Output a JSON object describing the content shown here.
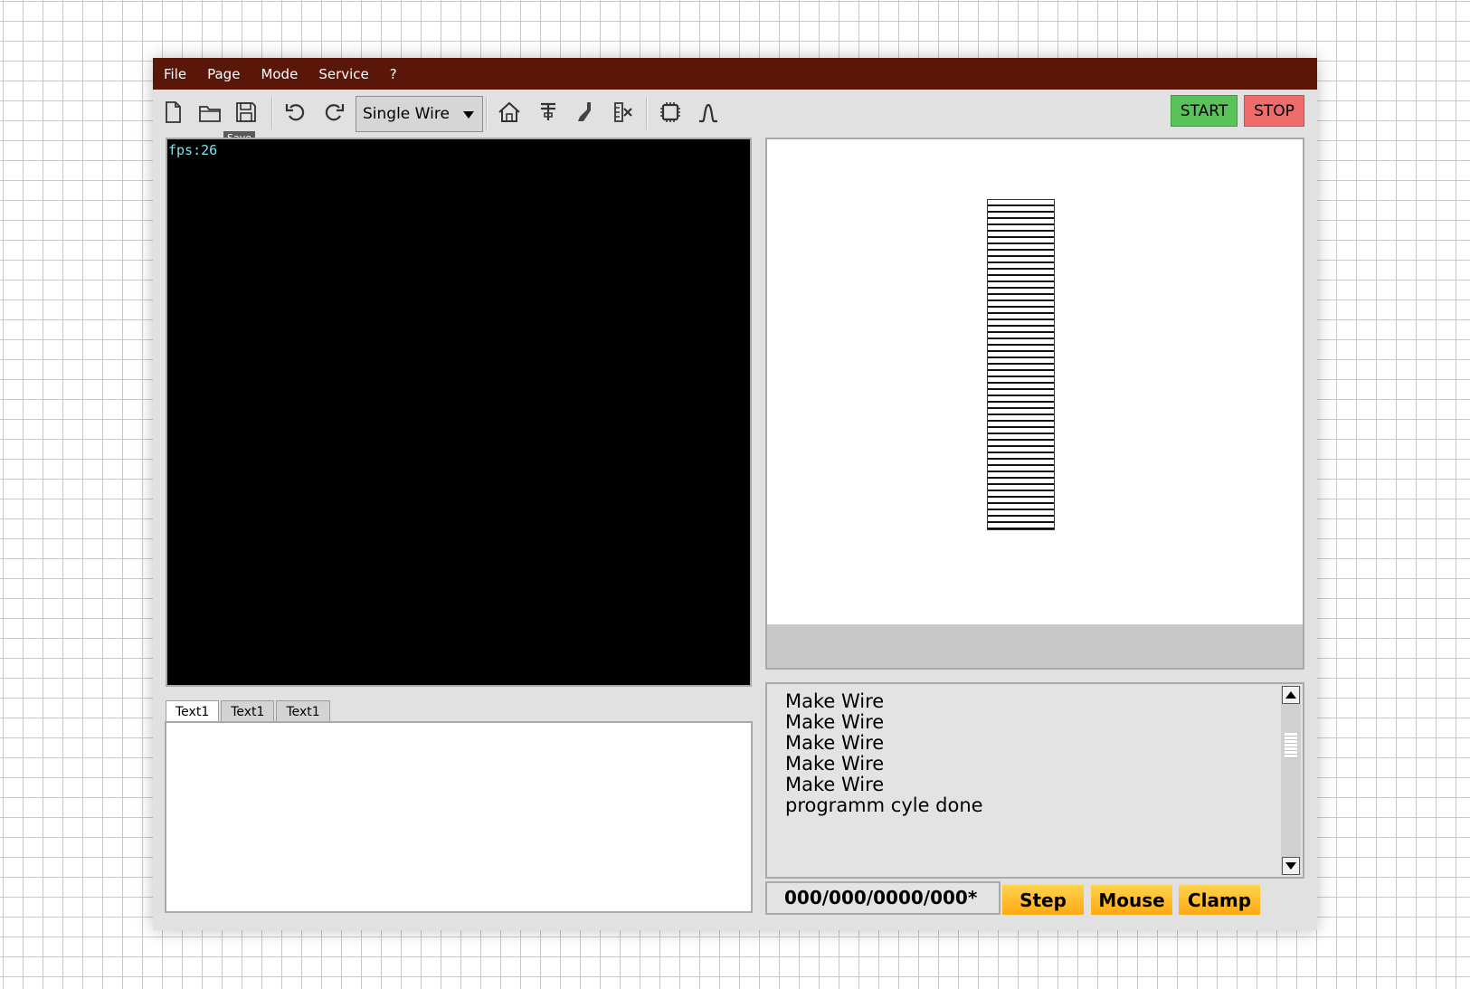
{
  "menu": {
    "items": [
      "File",
      "Page",
      "Mode",
      "Service",
      "?"
    ]
  },
  "toolbar": {
    "icons": {
      "new": "new-file-icon",
      "open": "open-folder-icon",
      "save": "save-icon",
      "undo": "undo-icon",
      "redo": "redo-icon",
      "home": "home-icon",
      "tool1": "bend-tool-icon",
      "tool2": "cutter-icon",
      "tool3": "strip-icon",
      "chip": "chip-icon",
      "curve": "curve-icon"
    },
    "tooltip": "Save",
    "mode_select": "Single Wire",
    "start_label": "START",
    "stop_label": "STOP"
  },
  "viewport": {
    "fps": "fps:26"
  },
  "tabs": [
    "Text1",
    "Text1",
    "Text1"
  ],
  "log": {
    "lines": [
      "Make Wire",
      "Make Wire",
      "Make Wire",
      "Make Wire",
      "Make Wire",
      "programm cyle done"
    ]
  },
  "status": {
    "counter": "000/000/0000/000*"
  },
  "actions": {
    "step_label": "Step",
    "mouse_label": "Mouse",
    "clamp_label": "Clamp"
  },
  "colors": {
    "menubar": "#5a1709",
    "start": "#59c259",
    "stop": "#ef6c6c",
    "action_button": "#ffb820",
    "fps_text": "#7fe3ea"
  }
}
